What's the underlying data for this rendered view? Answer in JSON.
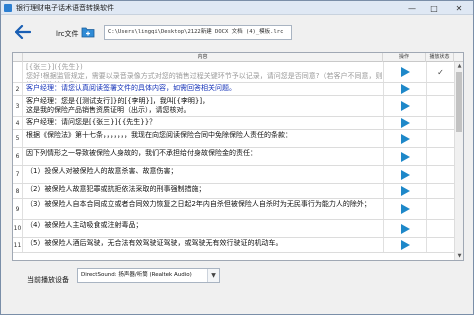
{
  "window": {
    "title": "银行理财电子话术语音转换软件",
    "minimize_glyph": "—",
    "maximize_glyph": "□",
    "close_glyph": "✕"
  },
  "toolbar": {
    "back_icon": "back-arrow-icon",
    "lrc_label": "lrc文件",
    "folder_icon": "folder-add-icon",
    "path_value": "C:\\Users\\lingqi\\Desktop\\2122新建 DOCX 文档 (4)_模板.lrc"
  },
  "grid": {
    "headers": {
      "num": "",
      "content": "内容",
      "op": "操作",
      "status": "播放状态"
    },
    "rows": [
      {
        "num": "",
        "text": "[{张三}]({先生})\n您好!根据监管规定，需要以录音录像方式对您的销售过程关键环节予以记录，请问您是否同意?（若客户不同意，则终止销售该产品）",
        "state": "dim",
        "status": "✓"
      },
      {
        "num": "2",
        "text": "客户经理：请您认真阅读签署文件的具体内容，如需回答相关问题。",
        "state": "blue",
        "status": ""
      },
      {
        "num": "3",
        "text": "客户经理：您是{[测试支行]}的[{李明}]，我叫[{李明}]，\n这是我的保险产品销售资质证明（出示），请您核对。",
        "state": "normal",
        "status": ""
      },
      {
        "num": "4",
        "text": "客户经理：请问您是[{张三}]{{先生}}？",
        "state": "normal",
        "status": ""
      },
      {
        "num": "5",
        "text": "根据《保险法》第十七条，，，，，，，我现在向您阅读保险合同中免除保险人责任的条款：",
        "state": "normal",
        "status": ""
      },
      {
        "num": "6",
        "text": "因下列情形之一导致被保险人身故的，我们不承担给付身故保险金的责任：",
        "state": "normal",
        "status": ""
      },
      {
        "num": "7",
        "text": "（1）投保人对被保险人的故意杀害、故意伤害；",
        "state": "normal",
        "status": ""
      },
      {
        "num": "8",
        "text": "（2）被保险人故意犯罪或抗拒依法采取的刑事强制措施；",
        "state": "normal",
        "status": ""
      },
      {
        "num": "9",
        "text": "（3）被保险人自本合同成立或者合同效力恢复之日起2年内自杀但被保险人自杀时为无民事行为能力人的除外；",
        "state": "normal",
        "status": ""
      },
      {
        "num": "10",
        "text": "（4）被保险人主动吸食或注射毒品；",
        "state": "normal",
        "status": ""
      },
      {
        "num": "11",
        "text": "（5）被保险人酒后驾驶，无合法有效驾驶证驾驶，或驾驶无有效行驶证的机动车。",
        "state": "normal",
        "status": ""
      }
    ]
  },
  "footer": {
    "device_label": "当前播放设备",
    "device_value": "DirectSound: 扬声器/听筒 (Realtek Audio)",
    "dropdown_glyph": "▼"
  },
  "colors": {
    "accent": "#1e88c9",
    "link_blue": "#1432b8",
    "dim_text": "#9a9a9a"
  }
}
